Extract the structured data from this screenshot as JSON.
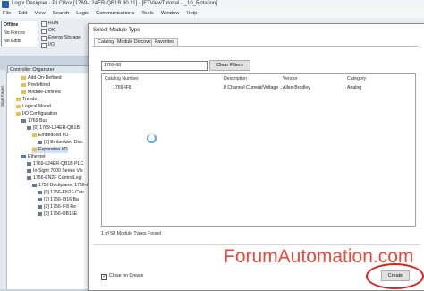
{
  "window": {
    "title": "Logix Designer - PLCBox [1769-L24ER-QB1B 30.11] - [FTViewTutorial - _10_Rotation]"
  },
  "menu": [
    "File",
    "Edit",
    "View",
    "Search",
    "Logic",
    "Communications",
    "Tools",
    "Window",
    "Help"
  ],
  "controller_status": {
    "mode": "Offline",
    "forces": "No Forces",
    "edits": "No Edits",
    "run": "RUN",
    "ok": "OK",
    "energy": "Energy Storage",
    "io": "I/O"
  },
  "organizer": {
    "title": "Controller Organizer",
    "items": [
      "Add-On-Defined",
      "Predefined",
      "Module-Defined",
      "Trends",
      "Logical Model",
      "I/O Configuration",
      "1769 Bus",
      "[0] 1769-L24ER-QB1B",
      "Embedded I/O",
      "[1] Embedded Disc",
      "Expansion I/O",
      "Ethernet",
      "1769-L24ER-QB1B PLC",
      "In-Sight 7000 Series Vis",
      "1756-EN2F ControlLogi",
      "1756 Backplane, 1756-A",
      "[0] 1756-EN2F Con",
      "[1] 1756-IB16 Ba",
      "[2] 1756-IF8 Re",
      "[3] 1756-OB16E"
    ],
    "side_tab": "Start Pages"
  },
  "dialog": {
    "title": "Select Module Type",
    "tabs": [
      "Catalog",
      "Module Discovery",
      "Favorites"
    ],
    "search_value": "1769-if8",
    "clear_filters": "Clear Filters",
    "columns": [
      "Catalog Number",
      "Description",
      "Vendor",
      "Category"
    ],
    "rows": [
      {
        "catalog": "1769-IF8",
        "description": "8 Channel Current/Voltage ...",
        "vendor": "Allen-Bradley",
        "category": "Analog"
      }
    ],
    "count_text": "1 of 58 Module Types Found",
    "close_on_create": "Close on Create",
    "close_on_create_checked": "✓",
    "create_button": "Create"
  },
  "watermark": "ForumAutomation.com",
  "colors": {
    "watermark": "#e84b3c",
    "highlight_ring": "#e02020"
  }
}
